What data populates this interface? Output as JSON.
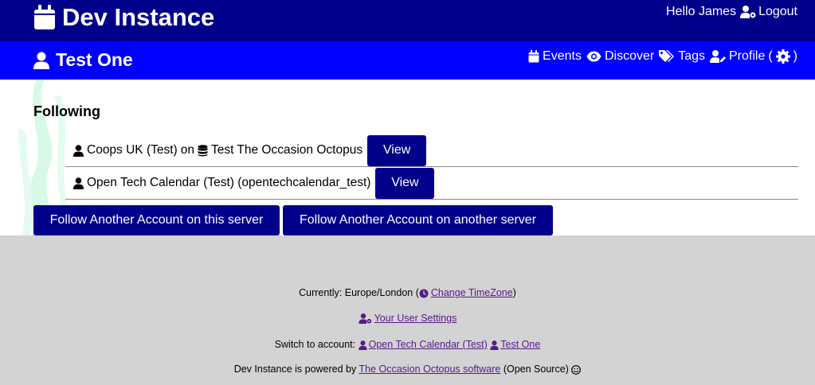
{
  "header": {
    "instance_title": "Dev Instance",
    "greeting": "Hello James",
    "logout_label": "Logout"
  },
  "account_bar": {
    "account_title": "Test One",
    "nav": {
      "events": "Events",
      "discover": "Discover",
      "tags": "Tags",
      "profile": "Profile",
      "paren_open": "(",
      "paren_close": ")"
    }
  },
  "main": {
    "heading": "Following",
    "rows": [
      {
        "account": "Coops UK (Test)",
        "joiner": "on",
        "server": "Test The Occasion Octopus",
        "button": "View"
      },
      {
        "account": "Open Tech Calendar (Test) (opentechcalendar_test)",
        "button": "View"
      }
    ],
    "follow_this_server": "Follow Another Account on this server",
    "follow_other_server": "Follow Another Account on another server"
  },
  "footer": {
    "timezone_prefix": "Currently: Europe/London (",
    "timezone_link": "Change TimeZone",
    "timezone_suffix": ")",
    "user_settings_link": "Your User Settings",
    "switch_prefix": "Switch to account:",
    "switch_accounts": [
      "Open Tech Calendar (Test)",
      "Test One"
    ],
    "powered_prefix": "Dev Instance is powered by",
    "powered_link": "The Occasion Octopus software",
    "powered_suffix": "(Open Source)"
  },
  "colors": {
    "header_bg": "#00008b",
    "account_bar_bg": "#0000ff",
    "button_bg": "#00008b",
    "footer_bg": "#d3d3d3",
    "link": "#551a8b"
  }
}
